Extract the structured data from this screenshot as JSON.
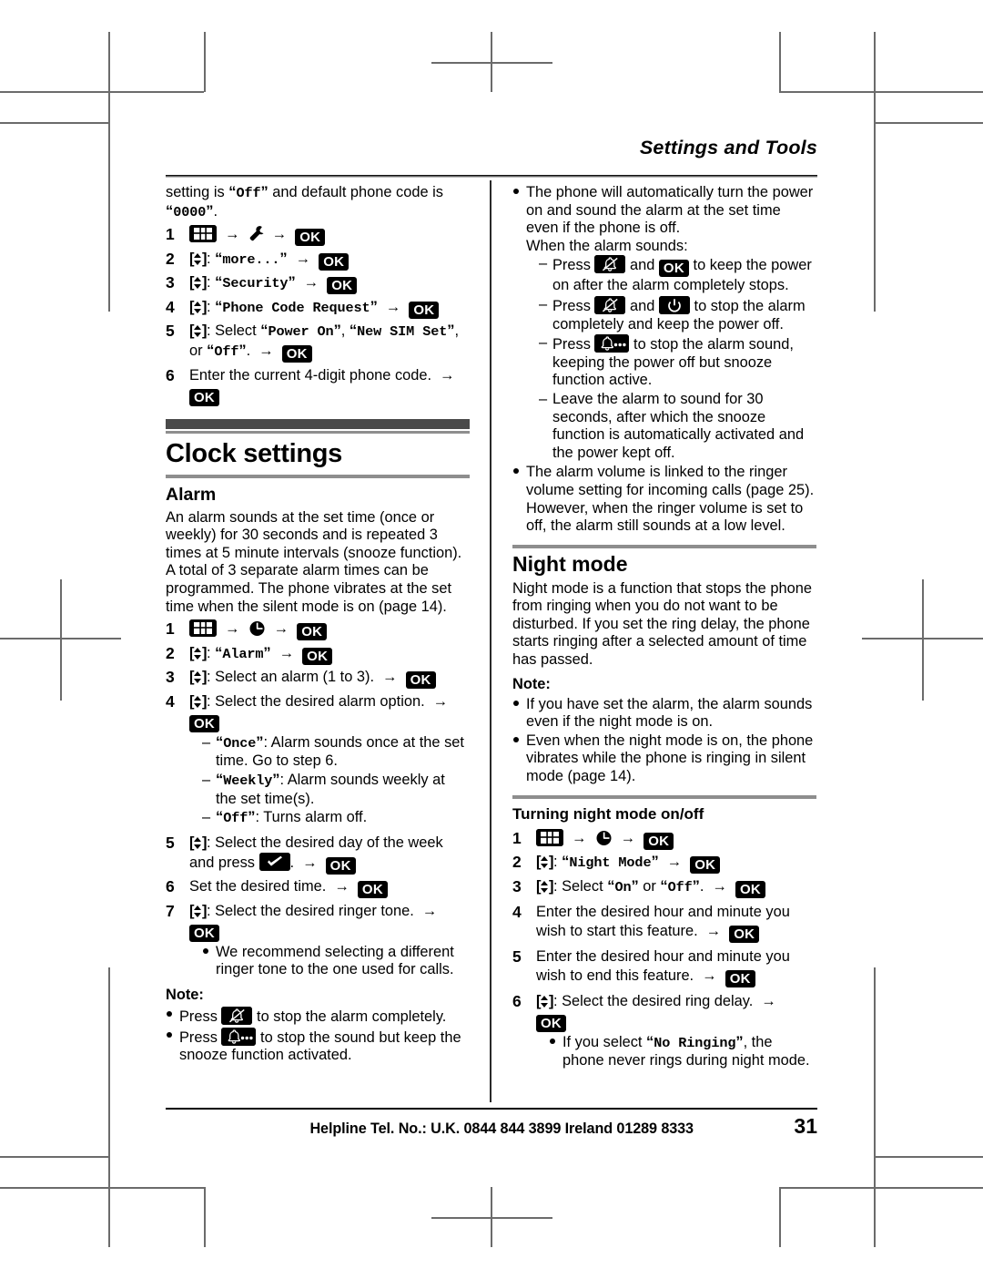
{
  "header": {
    "title": "Settings and Tools"
  },
  "footer": {
    "helpline": "Helpline Tel. No.: U.K. 0844 844 3899 Ireland 01289 8333",
    "page_number": "31"
  },
  "left_column": {
    "intro": {
      "pre": "setting is ",
      "q1": "Off",
      "mid": " and default phone code is ",
      "q2": "0000",
      "post": "."
    },
    "security_steps": [
      {
        "num": "1"
      },
      {
        "num": "2",
        "value": "more..."
      },
      {
        "num": "3",
        "value": "Security"
      },
      {
        "num": "4",
        "value": "Phone Code Request"
      },
      {
        "num": "5",
        "select_label": "Select",
        "opt1": "Power On",
        "opt2": "New SIM Set",
        "or_text": ", or ",
        "opt3": "Off",
        "period": "."
      },
      {
        "num": "6",
        "text": "Enter the current 4-digit phone code."
      }
    ],
    "clock_settings": {
      "title": "Clock settings",
      "alarm": {
        "title": "Alarm",
        "body": "An alarm sounds at the set time (once or weekly) for 30 seconds and is repeated 3 times at 5 minute intervals (snooze function). A total of 3 separate alarm times can be programmed. The phone vibrates at the set time when the silent mode is on (page 14).",
        "steps": [
          {
            "num": "1"
          },
          {
            "num": "2",
            "value": "Alarm"
          },
          {
            "num": "3",
            "text": "Select an alarm (1 to 3)."
          },
          {
            "num": "4",
            "text": "Select the desired alarm option."
          },
          {
            "num": "5",
            "text_a": "Select the desired day of the week and press",
            "text_b": "."
          },
          {
            "num": "6",
            "text": "Set the desired time."
          },
          {
            "num": "7",
            "text": "Select the desired ringer tone."
          }
        ],
        "option_items": [
          {
            "code": "Once",
            "text": ": Alarm sounds once at the set time. Go to step 6."
          },
          {
            "code": "Weekly",
            "text": ": Alarm sounds weekly at the set time(s)."
          },
          {
            "code": "Off",
            "text": ": Turns alarm off."
          }
        ],
        "tip": "We recommend selecting a different ringer tone to the one used for calls.",
        "note_label": "Note:",
        "notes": [
          {
            "pre": "Press",
            "post": "to stop the alarm completely.",
            "icon": "alarm-off-icon"
          },
          {
            "pre": "Press",
            "post": "to stop the sound but keep the snooze function activated.",
            "icon": "snooze-icon"
          }
        ]
      }
    }
  },
  "right_column": {
    "alarm_notes": {
      "lead": "The phone will automatically turn the power on and sound the alarm at the set time even if the phone is off.",
      "lead2": "When the alarm sounds:",
      "sub_items": [
        {
          "pre": "Press",
          "mid": "and",
          "post": "to keep the power on after the alarm completely stops."
        },
        {
          "pre": "Press",
          "mid": "and",
          "post": "to stop the alarm completely and keep the power off."
        },
        {
          "pre": "Press",
          "post": "to stop the alarm sound, keeping the power off but snooze function active."
        },
        {
          "text": "Leave the alarm to sound for 30 seconds, after which the snooze function is automatically activated and the power kept off."
        }
      ],
      "volume_note": "The alarm volume is linked to the ringer volume setting for incoming calls (page 25). However, when the ringer volume is set to off, the alarm still sounds at a low level."
    },
    "night_mode": {
      "title": "Night mode",
      "body": "Night mode is a function that stops the phone from ringing when you do not want to be disturbed. If you set the ring delay, the phone starts ringing after a selected amount of time has passed.",
      "note_label": "Note:",
      "notes": [
        "If you have set the alarm, the alarm sounds even if the night mode is on.",
        "Even when the night mode is on, the phone vibrates while the phone is ringing in silent mode (page 14)."
      ],
      "sub_title": "Turning night mode on/off",
      "steps": [
        {
          "num": "1"
        },
        {
          "num": "2",
          "value": "Night Mode"
        },
        {
          "num": "3",
          "select_label": "Select",
          "opt1": "On",
          "or_text": " or ",
          "opt2": "Off",
          "period": "."
        },
        {
          "num": "4",
          "text": "Enter the desired hour and minute you wish to start this feature."
        },
        {
          "num": "5",
          "text": "Enter the desired hour and minute you wish to end this feature."
        },
        {
          "num": "6",
          "text": "Select the desired ring delay."
        }
      ],
      "tip_pre": "If you select ",
      "tip_code": "No Ringing",
      "tip_post": ", the phone never rings during night mode."
    }
  },
  "keys": {
    "ok": "OK"
  },
  "colors": {
    "band": "#4a4a4a",
    "rule": "#8e8e8e",
    "key_bg": "#000000",
    "text": "#000000"
  }
}
